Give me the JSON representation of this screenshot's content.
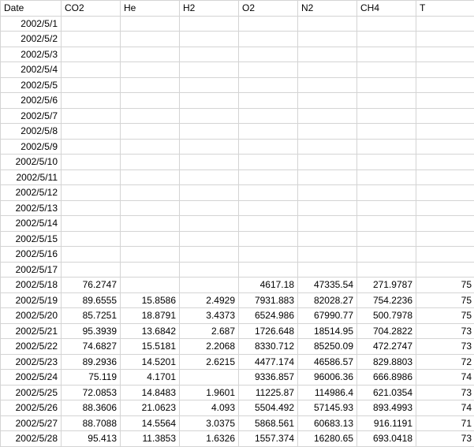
{
  "headers": [
    "Date",
    "CO2",
    "He",
    "H2",
    "O2",
    "N2",
    "CH4",
    "T"
  ],
  "rows": [
    {
      "date": "2002/5/1",
      "co2": "",
      "he": "",
      "h2": "",
      "o2": "",
      "n2": "",
      "ch4": "",
      "t": ""
    },
    {
      "date": "2002/5/2",
      "co2": "",
      "he": "",
      "h2": "",
      "o2": "",
      "n2": "",
      "ch4": "",
      "t": ""
    },
    {
      "date": "2002/5/3",
      "co2": "",
      "he": "",
      "h2": "",
      "o2": "",
      "n2": "",
      "ch4": "",
      "t": ""
    },
    {
      "date": "2002/5/4",
      "co2": "",
      "he": "",
      "h2": "",
      "o2": "",
      "n2": "",
      "ch4": "",
      "t": ""
    },
    {
      "date": "2002/5/5",
      "co2": "",
      "he": "",
      "h2": "",
      "o2": "",
      "n2": "",
      "ch4": "",
      "t": ""
    },
    {
      "date": "2002/5/6",
      "co2": "",
      "he": "",
      "h2": "",
      "o2": "",
      "n2": "",
      "ch4": "",
      "t": ""
    },
    {
      "date": "2002/5/7",
      "co2": "",
      "he": "",
      "h2": "",
      "o2": "",
      "n2": "",
      "ch4": "",
      "t": ""
    },
    {
      "date": "2002/5/8",
      "co2": "",
      "he": "",
      "h2": "",
      "o2": "",
      "n2": "",
      "ch4": "",
      "t": ""
    },
    {
      "date": "2002/5/9",
      "co2": "",
      "he": "",
      "h2": "",
      "o2": "",
      "n2": "",
      "ch4": "",
      "t": ""
    },
    {
      "date": "2002/5/10",
      "co2": "",
      "he": "",
      "h2": "",
      "o2": "",
      "n2": "",
      "ch4": "",
      "t": ""
    },
    {
      "date": "2002/5/11",
      "co2": "",
      "he": "",
      "h2": "",
      "o2": "",
      "n2": "",
      "ch4": "",
      "t": ""
    },
    {
      "date": "2002/5/12",
      "co2": "",
      "he": "",
      "h2": "",
      "o2": "",
      "n2": "",
      "ch4": "",
      "t": ""
    },
    {
      "date": "2002/5/13",
      "co2": "",
      "he": "",
      "h2": "",
      "o2": "",
      "n2": "",
      "ch4": "",
      "t": ""
    },
    {
      "date": "2002/5/14",
      "co2": "",
      "he": "",
      "h2": "",
      "o2": "",
      "n2": "",
      "ch4": "",
      "t": ""
    },
    {
      "date": "2002/5/15",
      "co2": "",
      "he": "",
      "h2": "",
      "o2": "",
      "n2": "",
      "ch4": "",
      "t": ""
    },
    {
      "date": "2002/5/16",
      "co2": "",
      "he": "",
      "h2": "",
      "o2": "",
      "n2": "",
      "ch4": "",
      "t": ""
    },
    {
      "date": "2002/5/17",
      "co2": "",
      "he": "",
      "h2": "",
      "o2": "",
      "n2": "",
      "ch4": "",
      "t": ""
    },
    {
      "date": "2002/5/18",
      "co2": "76.2747",
      "he": "",
      "h2": "",
      "o2": "4617.18",
      "n2": "47335.54",
      "ch4": "271.9787",
      "t": "75"
    },
    {
      "date": "2002/5/19",
      "co2": "89.6555",
      "he": "15.8586",
      "h2": "2.4929",
      "o2": "7931.883",
      "n2": "82028.27",
      "ch4": "754.2236",
      "t": "75"
    },
    {
      "date": "2002/5/20",
      "co2": "85.7251",
      "he": "18.8791",
      "h2": "3.4373",
      "o2": "6524.986",
      "n2": "67990.77",
      "ch4": "500.7978",
      "t": "75"
    },
    {
      "date": "2002/5/21",
      "co2": "95.3939",
      "he": "13.6842",
      "h2": "2.687",
      "o2": "1726.648",
      "n2": "18514.95",
      "ch4": "704.2822",
      "t": "73"
    },
    {
      "date": "2002/5/22",
      "co2": "74.6827",
      "he": "15.5181",
      "h2": "2.2068",
      "o2": "8330.712",
      "n2": "85250.09",
      "ch4": "472.2747",
      "t": "73"
    },
    {
      "date": "2002/5/23",
      "co2": "89.2936",
      "he": "14.5201",
      "h2": "2.6215",
      "o2": "4477.174",
      "n2": "46586.57",
      "ch4": "829.8803",
      "t": "72"
    },
    {
      "date": "2002/5/24",
      "co2": "75.119",
      "he": "4.1701",
      "h2": "",
      "o2": "9336.857",
      "n2": "96006.36",
      "ch4": "666.8986",
      "t": "74"
    },
    {
      "date": "2002/5/25",
      "co2": "72.0853",
      "he": "14.8483",
      "h2": "1.9601",
      "o2": "11225.87",
      "n2": "114986.4",
      "ch4": "621.0354",
      "t": "73"
    },
    {
      "date": "2002/5/26",
      "co2": "88.3606",
      "he": "21.0623",
      "h2": "4.093",
      "o2": "5504.492",
      "n2": "57145.93",
      "ch4": "893.4993",
      "t": "74"
    },
    {
      "date": "2002/5/27",
      "co2": "88.7088",
      "he": "14.5564",
      "h2": "3.0375",
      "o2": "5868.561",
      "n2": "60683.13",
      "ch4": "916.1191",
      "t": "71"
    },
    {
      "date": "2002/5/28",
      "co2": "95.413",
      "he": "11.3853",
      "h2": "1.6326",
      "o2": "1557.374",
      "n2": "16280.65",
      "ch4": "693.0418",
      "t": "73"
    }
  ]
}
